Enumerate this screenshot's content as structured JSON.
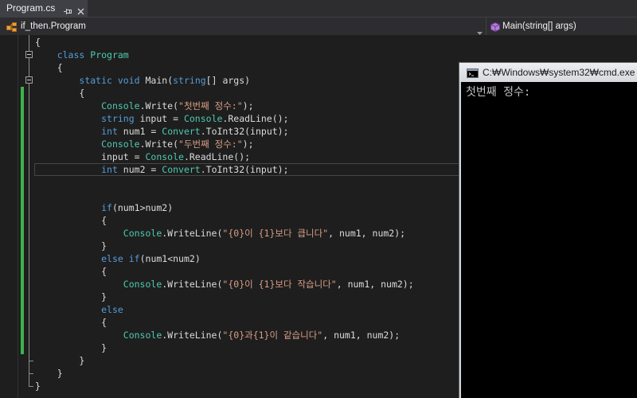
{
  "tab_strip": {
    "tabs": [
      {
        "label": "Program.cs",
        "active": true
      }
    ],
    "icons": {
      "pin": "pin-icon",
      "close": "close-icon"
    }
  },
  "nav_bar": {
    "type_selector": {
      "icon": "class-icon",
      "value": "if_then.Program"
    },
    "member_selector": {
      "icon": "method-icon",
      "value": "Main(string[] args)"
    },
    "dropdown_icon": "chevron-down-icon"
  },
  "editor": {
    "background": "#1e1e1e",
    "syntax_colors": {
      "keyword": "#569cd6",
      "type": "#4ec9b0",
      "string": "#d69d85",
      "plain": "#dcdcdc"
    },
    "change_marker_color": "#3cb44b",
    "lines": [
      {
        "tokens": [
          {
            "kind": "plain",
            "text": "{"
          }
        ]
      },
      {
        "outline": "box",
        "tokens": [
          {
            "kind": "plain",
            "text": "    "
          },
          {
            "kind": "keyword",
            "text": "class"
          },
          {
            "kind": "plain",
            "text": " "
          },
          {
            "kind": "type",
            "text": "Program"
          }
        ]
      },
      {
        "tokens": [
          {
            "kind": "plain",
            "text": "    {"
          }
        ]
      },
      {
        "outline": "box",
        "tokens": [
          {
            "kind": "plain",
            "text": "        "
          },
          {
            "kind": "keyword",
            "text": "static"
          },
          {
            "kind": "plain",
            "text": " "
          },
          {
            "kind": "keyword",
            "text": "void"
          },
          {
            "kind": "plain",
            "text": " Main("
          },
          {
            "kind": "keyword",
            "text": "string"
          },
          {
            "kind": "plain",
            "text": "[] args)"
          }
        ]
      },
      {
        "changed": true,
        "tokens": [
          {
            "kind": "plain",
            "text": "        {"
          }
        ]
      },
      {
        "changed": true,
        "tokens": [
          {
            "kind": "plain",
            "text": "            "
          },
          {
            "kind": "type",
            "text": "Console"
          },
          {
            "kind": "plain",
            "text": ".Write("
          },
          {
            "kind": "string",
            "text": "\"첫번째 정수:\""
          },
          {
            "kind": "plain",
            "text": ");"
          }
        ]
      },
      {
        "changed": true,
        "tokens": [
          {
            "kind": "plain",
            "text": "            "
          },
          {
            "kind": "keyword",
            "text": "string"
          },
          {
            "kind": "plain",
            "text": " input = "
          },
          {
            "kind": "type",
            "text": "Console"
          },
          {
            "kind": "plain",
            "text": ".ReadLine();"
          }
        ]
      },
      {
        "changed": true,
        "tokens": [
          {
            "kind": "plain",
            "text": "            "
          },
          {
            "kind": "keyword",
            "text": "int"
          },
          {
            "kind": "plain",
            "text": " num1 = "
          },
          {
            "kind": "type",
            "text": "Convert"
          },
          {
            "kind": "plain",
            "text": ".ToInt32(input);"
          }
        ]
      },
      {
        "changed": true,
        "tokens": [
          {
            "kind": "plain",
            "text": "            "
          },
          {
            "kind": "type",
            "text": "Console"
          },
          {
            "kind": "plain",
            "text": ".Write("
          },
          {
            "kind": "string",
            "text": "\"두번째 정수:\""
          },
          {
            "kind": "plain",
            "text": ");"
          }
        ]
      },
      {
        "changed": true,
        "tokens": [
          {
            "kind": "plain",
            "text": "            input = "
          },
          {
            "kind": "type",
            "text": "Console"
          },
          {
            "kind": "plain",
            "text": ".ReadLine();"
          }
        ]
      },
      {
        "changed": true,
        "current": true,
        "tokens": [
          {
            "kind": "plain",
            "text": "            "
          },
          {
            "kind": "keyword",
            "text": "int"
          },
          {
            "kind": "plain",
            "text": " num2 = "
          },
          {
            "kind": "type",
            "text": "Convert"
          },
          {
            "kind": "plain",
            "text": ".ToInt32(input);"
          }
        ]
      },
      {
        "changed": true,
        "tokens": []
      },
      {
        "changed": true,
        "tokens": []
      },
      {
        "changed": true,
        "tokens": [
          {
            "kind": "plain",
            "text": "            "
          },
          {
            "kind": "keyword",
            "text": "if"
          },
          {
            "kind": "plain",
            "text": "(num1>num2)"
          }
        ]
      },
      {
        "changed": true,
        "tokens": [
          {
            "kind": "plain",
            "text": "            {"
          }
        ]
      },
      {
        "changed": true,
        "tokens": [
          {
            "kind": "plain",
            "text": "                "
          },
          {
            "kind": "type",
            "text": "Console"
          },
          {
            "kind": "plain",
            "text": ".WriteLine("
          },
          {
            "kind": "string",
            "text": "\"{0}이 {1}보다 큽니다\""
          },
          {
            "kind": "plain",
            "text": ", num1, num2);"
          }
        ]
      },
      {
        "changed": true,
        "tokens": [
          {
            "kind": "plain",
            "text": "            }"
          }
        ]
      },
      {
        "changed": true,
        "tokens": [
          {
            "kind": "plain",
            "text": "            "
          },
          {
            "kind": "keyword",
            "text": "else"
          },
          {
            "kind": "plain",
            "text": " "
          },
          {
            "kind": "keyword",
            "text": "if"
          },
          {
            "kind": "plain",
            "text": "(num1<num2)"
          }
        ]
      },
      {
        "changed": true,
        "tokens": [
          {
            "kind": "plain",
            "text": "            {"
          }
        ]
      },
      {
        "changed": true,
        "tokens": [
          {
            "kind": "plain",
            "text": "                "
          },
          {
            "kind": "type",
            "text": "Console"
          },
          {
            "kind": "plain",
            "text": ".WriteLine("
          },
          {
            "kind": "string",
            "text": "\"{0}이 {1}보다 작습니다\""
          },
          {
            "kind": "plain",
            "text": ", num1, num2);"
          }
        ]
      },
      {
        "changed": true,
        "tokens": [
          {
            "kind": "plain",
            "text": "            }"
          }
        ]
      },
      {
        "changed": true,
        "tokens": [
          {
            "kind": "plain",
            "text": "            "
          },
          {
            "kind": "keyword",
            "text": "else"
          }
        ]
      },
      {
        "changed": true,
        "tokens": [
          {
            "kind": "plain",
            "text": "            {"
          }
        ]
      },
      {
        "changed": true,
        "tokens": [
          {
            "kind": "plain",
            "text": "                "
          },
          {
            "kind": "type",
            "text": "Console"
          },
          {
            "kind": "plain",
            "text": ".WriteLine("
          },
          {
            "kind": "string",
            "text": "\"{0}과{1}이 같습니다\""
          },
          {
            "kind": "plain",
            "text": ", num1, num2);"
          }
        ]
      },
      {
        "changed": true,
        "tokens": [
          {
            "kind": "plain",
            "text": "            }"
          }
        ]
      },
      {
        "outline": "end",
        "tokens": [
          {
            "kind": "plain",
            "text": "        }"
          }
        ]
      },
      {
        "outline": "end",
        "tokens": [
          {
            "kind": "plain",
            "text": "    }"
          }
        ]
      },
      {
        "outline": "end",
        "tokens": [
          {
            "kind": "plain",
            "text": "}"
          }
        ]
      }
    ]
  },
  "console_window": {
    "title": "C:₩Windows₩system32₩cmd.exe",
    "icon": "cmd-icon",
    "output_lines": [
      "첫번째 정수:"
    ],
    "text_color": "#c0c0c0",
    "background": "#000000"
  }
}
